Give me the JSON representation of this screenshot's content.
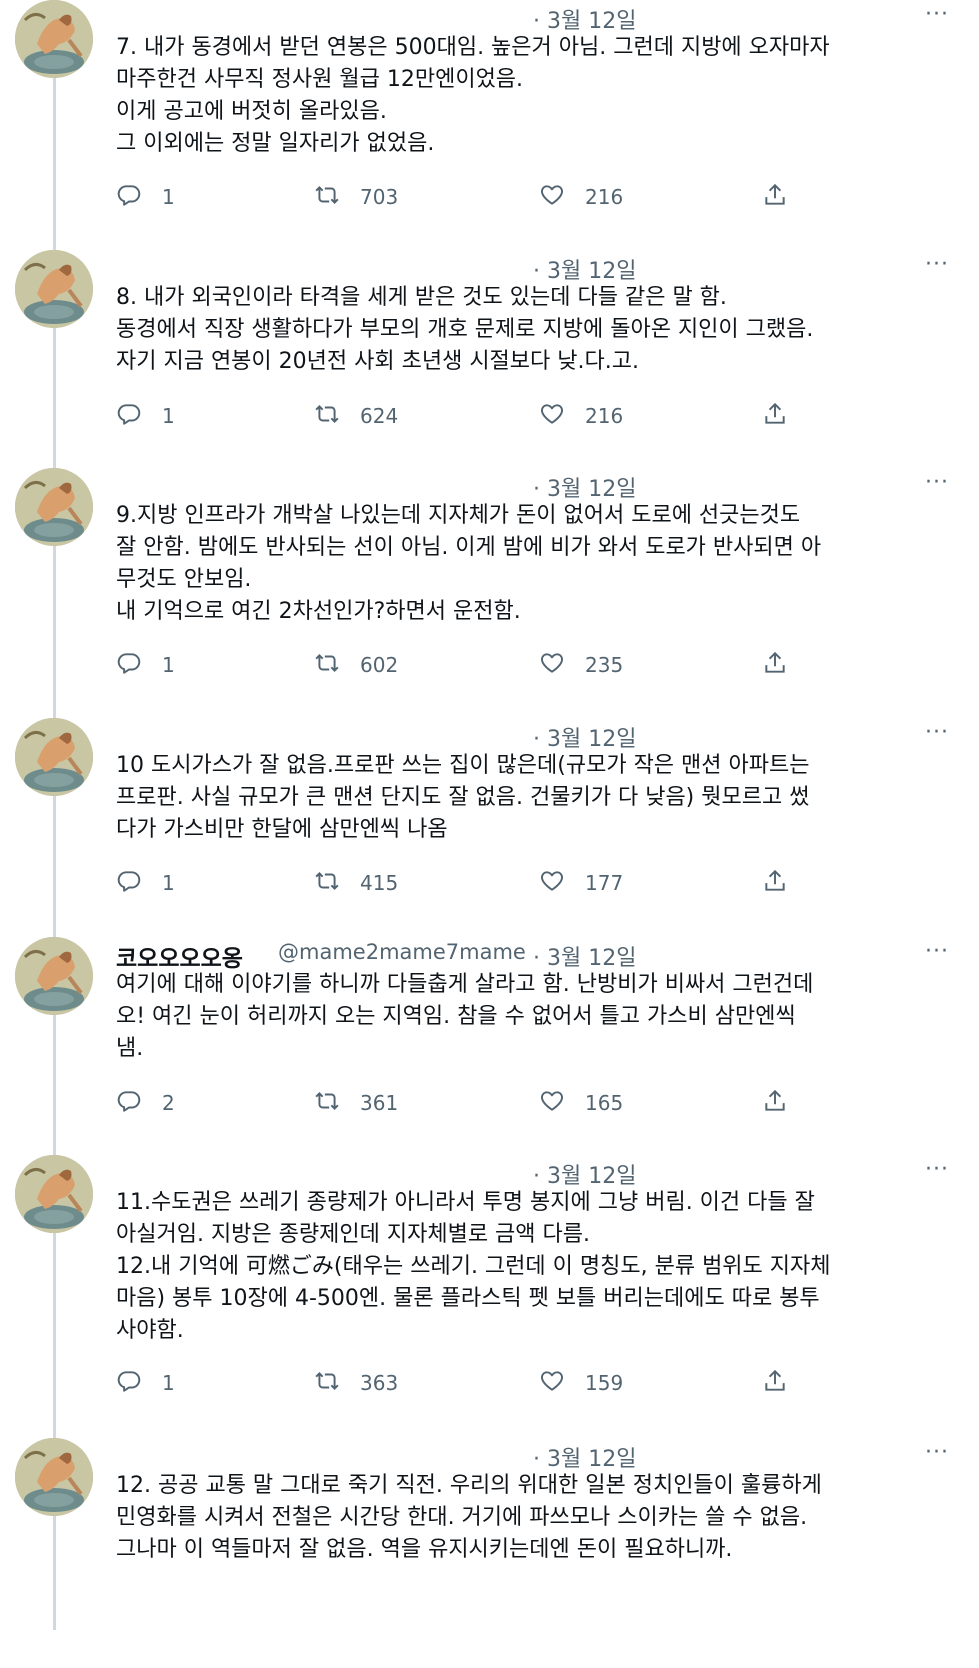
{
  "more_label": "···",
  "tweets": [
    {
      "name": "",
      "handle": "",
      "date": "· 3월 12일",
      "text": "7. 내가 동경에서 받던 연봉은 500대임. 높은거 아님. 그런데 지방에 오자마자\n마주한건 사무직 정사원 월급 12만엔이었음.\n이게 공고에 버젓히 올라있음.\n그 이외에는 정말 일자리가 없었음.",
      "replies": "1",
      "retweets": "703",
      "likes": "216"
    },
    {
      "name": "",
      "handle": "",
      "date": "· 3월 12일",
      "text": "8. 내가 외국인이라 타격을 세게 받은 것도 있는데 다들 같은 말 함.\n동경에서 직장 생활하다가 부모의 개호 문제로 지방에 돌아온 지인이 그랬음.\n자기 지금 연봉이 20년전 사회 초년생 시절보다 낮.다.고.",
      "replies": "1",
      "retweets": "624",
      "likes": "216"
    },
    {
      "name": "",
      "handle": "",
      "date": "· 3월 12일",
      "text": "9.지방 인프라가 개박살 나있는데 지자체가 돈이 없어서 도로에 선긋는것도\n잘 안함. 밤에도 반사되는 선이 아님. 이게 밤에 비가 와서 도로가 반사되면 아\n무것도 안보임.\n내 기억으로 여긴 2차선인가?하면서 운전함.",
      "replies": "1",
      "retweets": "602",
      "likes": "235"
    },
    {
      "name": "",
      "handle": "",
      "date": "· 3월 12일",
      "text": "10 도시가스가 잘 없음.프로판 쓰는 집이 많은데(규모가 작은 맨션 아파트는\n프로판. 사실 규모가 큰 맨션 단지도 잘 없음. 건물키가 다 낮음) 뭣모르고 썼\n다가 가스비만 한달에 삼만엔씩 나옴",
      "replies": "1",
      "retweets": "415",
      "likes": "177"
    },
    {
      "name": "코오오오오옹",
      "handle": "@mame2mame7mame",
      "date": "· 3월 12일",
      "text": "여기에 대해 이야기를 하니까 다들춥게 살라고 함. 난방비가 비싸서 그런건데\n오! 여긴 눈이 허리까지 오는 지역임. 참을 수 없어서 틀고 가스비 삼만엔씩\n냄.",
      "replies": "2",
      "retweets": "361",
      "likes": "165"
    },
    {
      "name": "",
      "handle": "",
      "date": "· 3월 12일",
      "text": "11.수도권은 쓰레기 종량제가 아니라서 투명 봉지에 그냥 버림. 이건 다들 잘\n아실거임. 지방은 종량제인데 지자체별로 금액 다름.\n12.내 기억에 可燃ごみ(태우는 쓰레기. 그런데 이 명칭도, 분류 범위도 지자체\n마음) 봉투 10장에 4-500엔. 물론 플라스틱 펫 보틀 버리는데에도 따로 봉투\n사야함.",
      "replies": "1",
      "retweets": "363",
      "likes": "159"
    },
    {
      "name": "",
      "handle": "",
      "date": "· 3월 12일",
      "text": "12. 공공 교통 말 그대로 죽기 직전. 우리의 위대한 일본 정치인들이 훌륭하게\n민영화를 시켜서 전철은 시간당 한대. 거기에 파쓰모나 스이카는 쓸 수 없음.\n그나마 이 역들마저 잘 없음. 역을 유지시키는데엔 돈이 필요하니까.",
      "replies": "",
      "retweets": "",
      "likes": ""
    }
  ]
}
